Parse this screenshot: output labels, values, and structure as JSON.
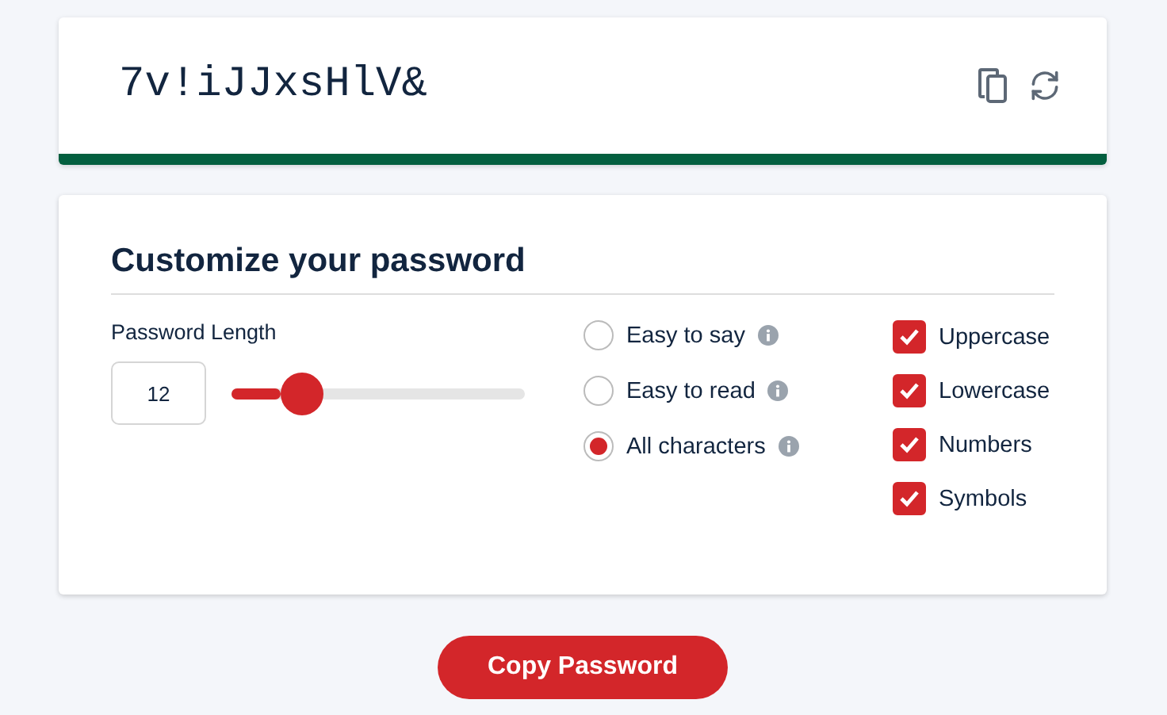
{
  "password": {
    "value": "7v!iJJxsHlV&"
  },
  "strength": {
    "level": 1,
    "color": "#035f3f"
  },
  "customize": {
    "title": "Customize your password",
    "length_label": "Password Length",
    "length_value": "12",
    "length": {
      "level": 0.24
    },
    "modes": [
      {
        "label": "Easy to say",
        "selected": false
      },
      {
        "label": "Easy to read",
        "selected": false
      },
      {
        "label": "All characters",
        "selected": true
      }
    ],
    "options": [
      {
        "label": "Uppercase",
        "checked": true
      },
      {
        "label": "Lowercase",
        "checked": true
      },
      {
        "label": "Numbers",
        "checked": true
      },
      {
        "label": "Symbols",
        "checked": true
      }
    ]
  },
  "copy_button": "Copy Password"
}
